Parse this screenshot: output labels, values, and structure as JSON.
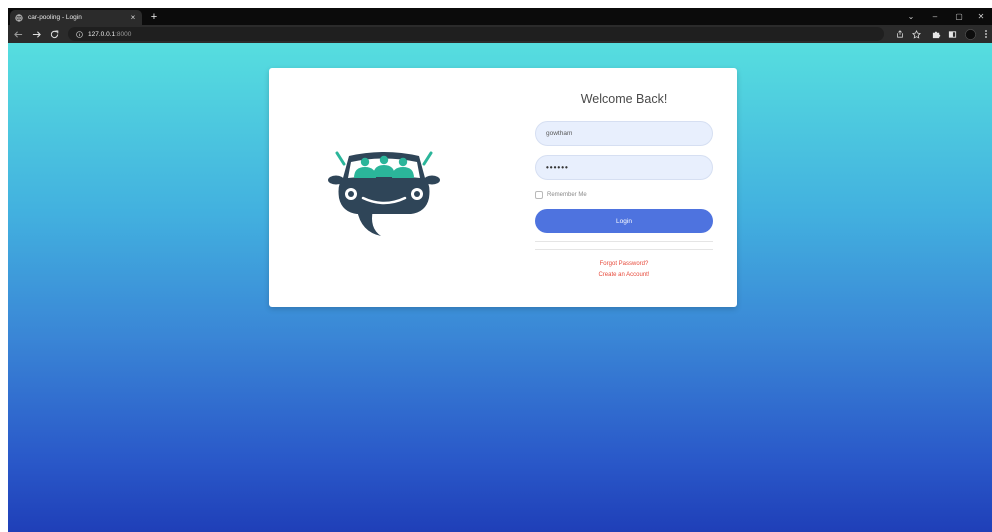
{
  "browser": {
    "tab_title": "car-pooling - Login",
    "tab_close": "×",
    "new_tab": "+",
    "url_host": "127.0.0.1",
    "url_port": ":8000",
    "controls": {
      "minimize": "–",
      "restore": "▢",
      "close": "✕",
      "tab_list": "⌄"
    }
  },
  "page": {
    "title": "Welcome Back!",
    "username_value": "gowtham",
    "password_value": "••••••",
    "remember_label": "Remember Me",
    "login_label": "Login",
    "forgot_link": "Forgot Password?",
    "create_link": "Create an Account!"
  },
  "colors": {
    "accent": "#4e73df",
    "link": "#e74a3b",
    "logo_dark": "#2f4558",
    "logo_teal": "#2bb59a",
    "gradient_top": "#56dedf",
    "gradient_bottom": "#1f3fb8"
  },
  "icons": {
    "favicon": "globe-icon",
    "back": "arrow-left-icon",
    "forward": "arrow-right-icon",
    "reload": "reload-icon",
    "info": "info-icon",
    "share": "share-icon",
    "bookmark": "star-icon",
    "extensions": "puzzle-icon",
    "sidepanel": "side-panel-icon",
    "profile": "avatar-icon",
    "menu": "kebab-menu-icon"
  }
}
